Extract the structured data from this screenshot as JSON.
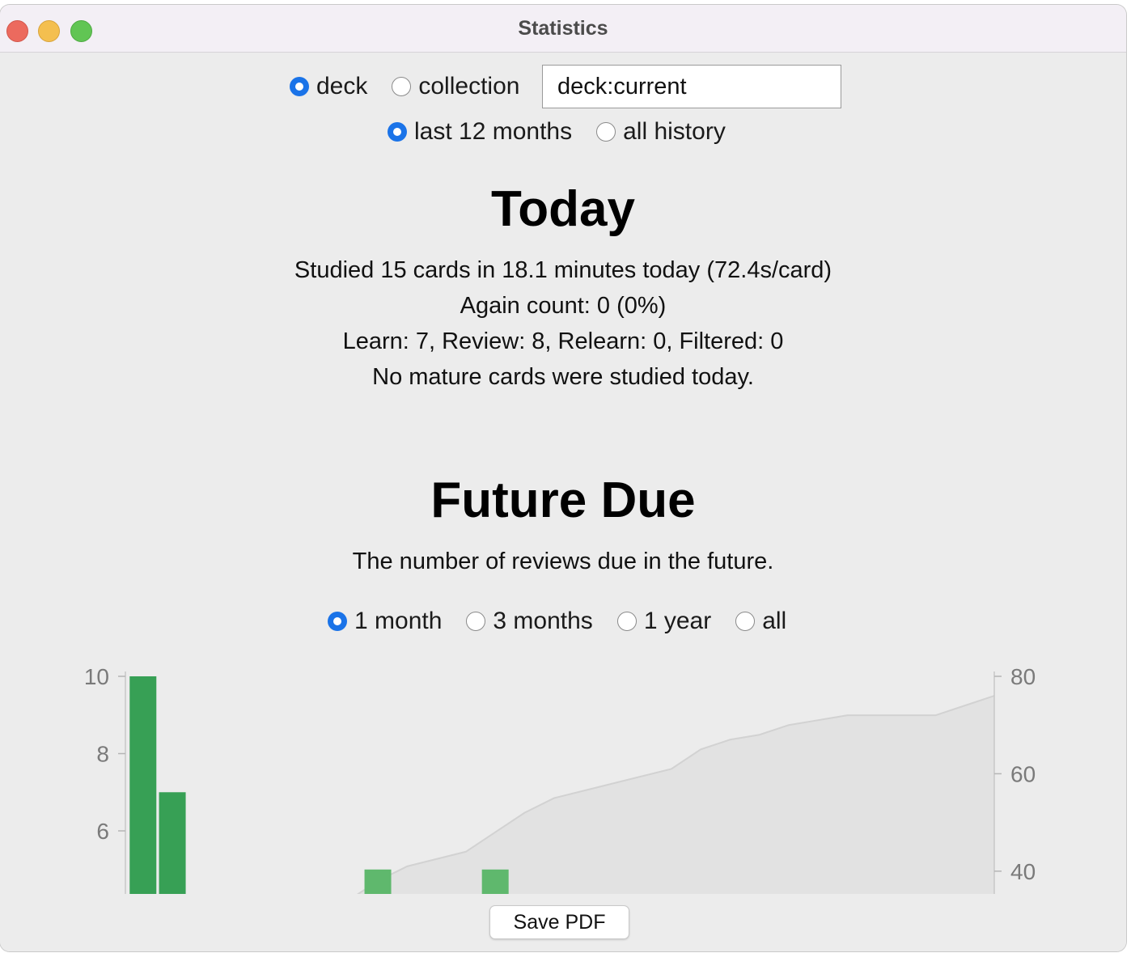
{
  "window": {
    "title": "Statistics"
  },
  "scope": {
    "options": [
      {
        "label": "deck",
        "selected": true
      },
      {
        "label": "collection",
        "selected": false
      }
    ],
    "search_value": "deck:current"
  },
  "period": {
    "options": [
      {
        "label": "last 12 months",
        "selected": true
      },
      {
        "label": "all history",
        "selected": false
      }
    ]
  },
  "today": {
    "title": "Today",
    "lines": [
      "Studied 15 cards in 18.1 minutes today (72.4s/card)",
      "Again count: 0 (0%)",
      "Learn: 7, Review: 8, Relearn: 0, Filtered: 0",
      "No mature cards were studied today."
    ]
  },
  "future_due": {
    "title": "Future Due",
    "subtitle": "The number of reviews due in the future.",
    "range_options": [
      {
        "label": "1 month",
        "selected": true
      },
      {
        "label": "3 months",
        "selected": false
      },
      {
        "label": "1 year",
        "selected": false
      },
      {
        "label": "all",
        "selected": false
      }
    ]
  },
  "chart_data": {
    "type": "bar",
    "x": [
      1,
      2,
      9,
      13
    ],
    "values": [
      10,
      7,
      5,
      5
    ],
    "bar_colors": [
      "#37a055",
      "#37a055",
      "#5fb86d",
      "#5fb86d"
    ],
    "left_ticks": [
      6,
      8,
      10
    ],
    "right_ticks": [
      40,
      60,
      80
    ],
    "ylim_left": [
      4.2,
      10
    ],
    "ylim_right": [
      34,
      80
    ],
    "cumulative": {
      "x": [
        8,
        9,
        10,
        12,
        13,
        14,
        15,
        17,
        19,
        20,
        21,
        22,
        23,
        24,
        25,
        26,
        27,
        28,
        29,
        30
      ],
      "values": [
        34,
        38,
        41,
        44,
        48,
        52,
        55,
        58,
        61,
        65,
        67,
        68,
        70,
        71,
        72,
        72,
        72,
        72,
        74,
        76
      ],
      "fill_color": "#e2e2e2",
      "line_color": "#d2d2d2"
    },
    "grid": false
  },
  "actions": {
    "save_pdf_label": "Save PDF"
  }
}
